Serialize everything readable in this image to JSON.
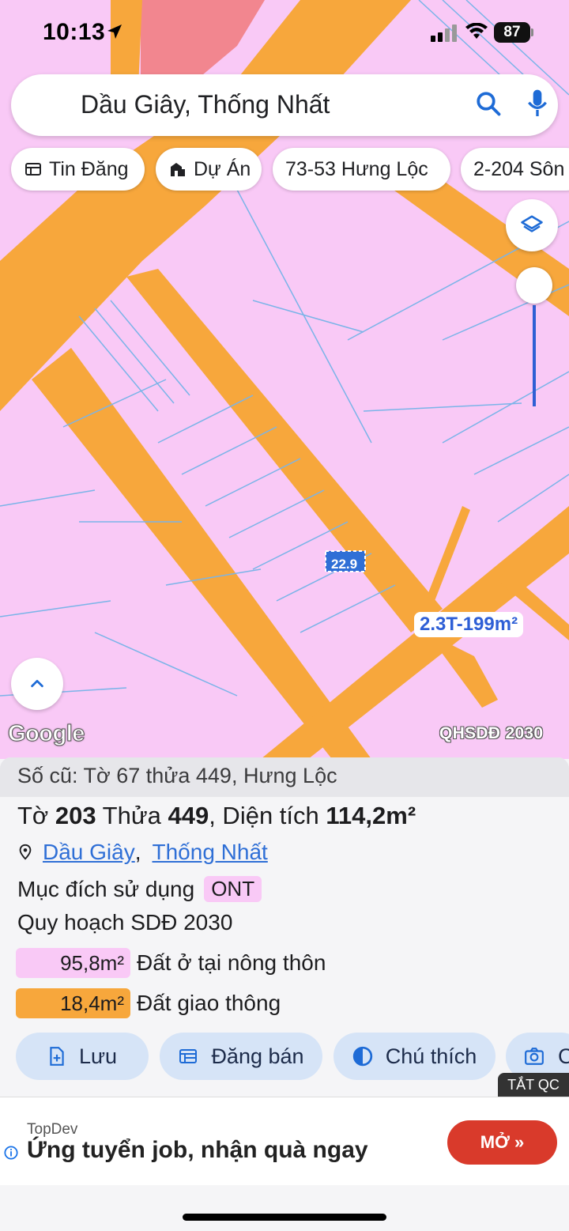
{
  "status": {
    "time": "10:13",
    "battery": "87"
  },
  "search": {
    "query": "Dầu Giây, Thống Nhất"
  },
  "chips": [
    {
      "label": "Tin Đăng",
      "icon": "listing-icon"
    },
    {
      "label": "Dự Án",
      "icon": "building-icon"
    },
    {
      "label": "73-53 Hưng Lộc"
    },
    {
      "label": "2-204 Sôn"
    }
  ],
  "map": {
    "google_logo": "Google",
    "plan_label": "QHSDĐ 2030",
    "price_label": "2.3T-199m²",
    "parcel_number": "22.9",
    "colors": {
      "residential": "#f9c9f6",
      "road": "#f7a73c",
      "parcel_line": "#7ab4e8"
    }
  },
  "info": {
    "old_info": "Số cũ: Tờ 67 thửa 449, Hưng Lộc",
    "title_pre": "Tờ ",
    "sheet": "203",
    "title_mid": " Thửa ",
    "plot": "449",
    "title_area_label": ", Diện tích ",
    "area": "114,2m²",
    "location_district": "Dầu Giây",
    "location_sep": ",",
    "location_province": "Thống Nhất",
    "purpose_label": "Mục đích sử dụng",
    "purpose_code": "ONT",
    "plan_label": "Quy hoạch SDĐ 2030",
    "land_uses": [
      {
        "area": "95,8m²",
        "label": "Đất ở tại nông thôn",
        "color": "#f9c9f6"
      },
      {
        "area": "18,4m²",
        "label": "Đất giao thông",
        "color": "#f7a73c"
      }
    ]
  },
  "actions": [
    {
      "label": "Lưu"
    },
    {
      "label": "Đăng bán"
    },
    {
      "label": "Chú thích"
    },
    {
      "label": "C"
    }
  ],
  "ad": {
    "dismiss": "TẮT QC",
    "brand": "TopDev",
    "title": "Ứng tuyển job, nhận quà ngay",
    "cta": "MỞ »"
  }
}
